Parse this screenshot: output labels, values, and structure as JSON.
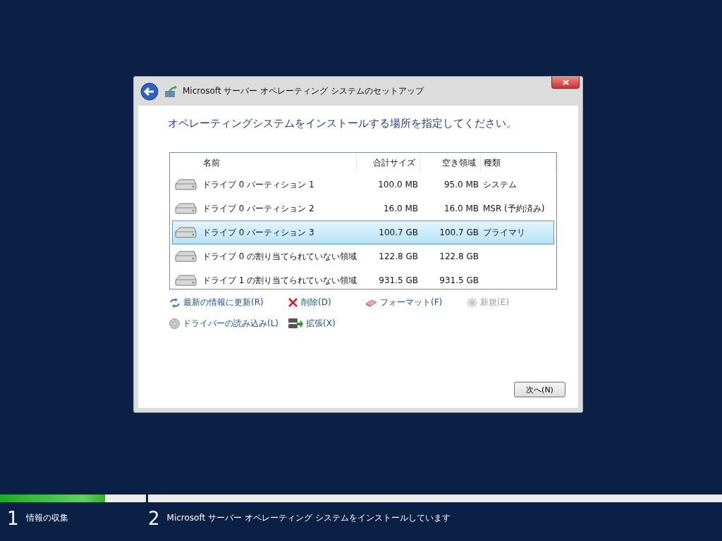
{
  "window": {
    "title": "Microsoft サーバー オペレーティング システムのセットアップ"
  },
  "heading": "オペレーティングシステムをインストールする場所を指定してください。",
  "table": {
    "columns": [
      "名前",
      "合計サイズ",
      "空き領域",
      "種類"
    ],
    "rows": [
      {
        "name": "ドライブ 0 パーティション 1",
        "total": "100.0 MB",
        "free": "95.0 MB",
        "type": "システム",
        "selected": false
      },
      {
        "name": "ドライブ 0 パーティション 2",
        "total": "16.0 MB",
        "free": "16.0 MB",
        "type": "MSR (予約済み)",
        "selected": false
      },
      {
        "name": "ドライブ 0 パーティション 3",
        "total": "100.7 GB",
        "free": "100.7 GB",
        "type": "プライマリ",
        "selected": true
      },
      {
        "name": "ドライブ 0 の割り当てられていない領域",
        "total": "122.8 GB",
        "free": "122.8 GB",
        "selected": false
      },
      {
        "name": "ドライブ 1 の割り当てられていない領域",
        "total": "931.5 GB",
        "free": "931.5 GB",
        "selected": false
      }
    ]
  },
  "actions": [
    {
      "kind": "refresh",
      "label": "最新の情報に更新(R)",
      "disabled": false
    },
    {
      "kind": "delete",
      "label": "削除(D)",
      "disabled": false
    },
    {
      "kind": "format",
      "label": "フォーマット(F)",
      "disabled": false
    },
    {
      "kind": "new",
      "label": "新規(E)",
      "disabled": true
    },
    {
      "kind": "driver",
      "label": "ドライバーの読み込み(L)",
      "disabled": false
    },
    {
      "kind": "extend",
      "label": "拡張(X)",
      "disabled": false
    }
  ],
  "next_button": "次へ(N)",
  "steps": [
    {
      "number": "1",
      "label": "情報の収集",
      "level": 0.72
    },
    {
      "number": "2",
      "label": "Microsoft サーバー オペレーティング システムをインストールしています",
      "level": 0
    }
  ]
}
